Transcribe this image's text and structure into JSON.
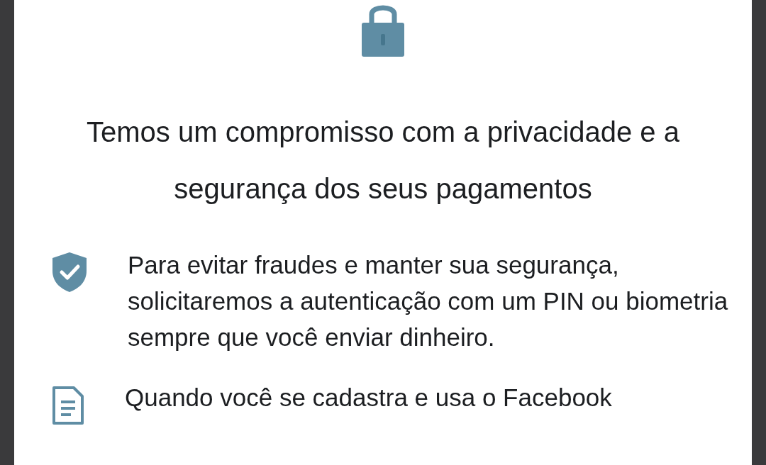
{
  "heading": "Temos um compromisso com a privacidade e a segurança dos seus pagamentos",
  "items": [
    {
      "kind": "shield",
      "text": "Para evitar fraudes e manter sua segurança, solicitaremos a autenticação com um PIN ou biometria sempre que você enviar dinheiro."
    },
    {
      "kind": "document",
      "text": "Quando você se cadastra e usa o Facebook"
    }
  ]
}
